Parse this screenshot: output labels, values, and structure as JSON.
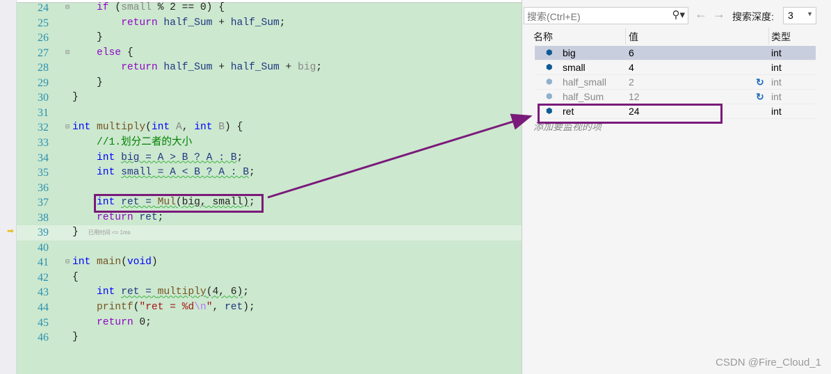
{
  "editor": {
    "lines": [
      {
        "n": "24",
        "fold": "⊟",
        "tokens": [
          [
            "",
            "    "
          ],
          [
            "ret",
            "if"
          ],
          [
            "",
            " ("
          ],
          [
            "dim",
            "small"
          ],
          [
            "",
            " % 2 == 0) {"
          ]
        ]
      },
      {
        "n": "25",
        "tokens": [
          [
            "",
            "        "
          ],
          [
            "ret",
            "return"
          ],
          [
            "",
            " "
          ],
          [
            "var",
            "half_Sum"
          ],
          [
            "",
            " + "
          ],
          [
            "var",
            "half_Sum"
          ],
          [
            "",
            ";"
          ]
        ]
      },
      {
        "n": "26",
        "tokens": [
          [
            "",
            "    }"
          ]
        ]
      },
      {
        "n": "27",
        "fold": "⊟",
        "tokens": [
          [
            "",
            "    "
          ],
          [
            "ret",
            "else"
          ],
          [
            "",
            " {"
          ]
        ]
      },
      {
        "n": "28",
        "tokens": [
          [
            "",
            "        "
          ],
          [
            "ret",
            "return"
          ],
          [
            "",
            " "
          ],
          [
            "var",
            "half_Sum"
          ],
          [
            "",
            " + "
          ],
          [
            "var",
            "half_Sum"
          ],
          [
            "",
            " + "
          ],
          [
            "dim",
            "big"
          ],
          [
            "",
            ";"
          ]
        ]
      },
      {
        "n": "29",
        "tokens": [
          [
            "",
            "    }"
          ]
        ]
      },
      {
        "n": "30",
        "tokens": [
          [
            "",
            "}"
          ]
        ]
      },
      {
        "n": "31",
        "tokens": []
      },
      {
        "n": "32",
        "fold": "⊟",
        "tokens": [
          [
            "kw",
            "int"
          ],
          [
            "",
            " "
          ],
          [
            "fn",
            "multiply"
          ],
          [
            "",
            "("
          ],
          [
            "kw",
            "int"
          ],
          [
            "",
            " "
          ],
          [
            "dim",
            "A"
          ],
          [
            "",
            ", "
          ],
          [
            "kw",
            "int"
          ],
          [
            "",
            " "
          ],
          [
            "dim",
            "B"
          ],
          [
            "",
            ") {"
          ]
        ]
      },
      {
        "n": "33",
        "tokens": [
          [
            "",
            "    "
          ],
          [
            "cm",
            "//1.划分二者的大小"
          ]
        ]
      },
      {
        "n": "34",
        "tokens": [
          [
            "",
            "    "
          ],
          [
            "kw",
            "int"
          ],
          [
            "",
            " "
          ],
          [
            "var sq",
            "big = A > B ? A : B"
          ],
          [
            "",
            ";"
          ]
        ]
      },
      {
        "n": "35",
        "tokens": [
          [
            "",
            "    "
          ],
          [
            "kw",
            "int"
          ],
          [
            "",
            " "
          ],
          [
            "var sq",
            "small = A < B ? A : B"
          ],
          [
            "",
            ";"
          ]
        ]
      },
      {
        "n": "36",
        "tokens": []
      },
      {
        "n": "37",
        "tokens": [
          [
            "",
            "    "
          ],
          [
            "kw",
            "int"
          ],
          [
            "",
            " "
          ],
          [
            "var sq",
            "ret = "
          ],
          [
            "fn sq",
            "Mul"
          ],
          [
            "sq",
            "(big, small)"
          ],
          [
            "",
            ";"
          ]
        ]
      },
      {
        "n": "38",
        "tokens": [
          [
            "",
            "    "
          ],
          [
            "ret",
            "return"
          ],
          [
            "",
            " "
          ],
          [
            "var",
            "ret"
          ],
          [
            "",
            ";"
          ]
        ]
      },
      {
        "n": "39",
        "current": true,
        "hint": "已用时间 <= 1ms",
        "tokens": [
          [
            "",
            "}"
          ]
        ]
      },
      {
        "n": "40",
        "tokens": []
      },
      {
        "n": "41",
        "fold": "⊟",
        "tokens": [
          [
            "kw",
            "int"
          ],
          [
            "",
            " "
          ],
          [
            "fn",
            "main"
          ],
          [
            "",
            "("
          ],
          [
            "kw",
            "void"
          ],
          [
            "",
            ")"
          ]
        ]
      },
      {
        "n": "42",
        "tokens": [
          [
            "",
            "{"
          ]
        ]
      },
      {
        "n": "43",
        "tokens": [
          [
            "",
            "    "
          ],
          [
            "kw",
            "int"
          ],
          [
            "",
            " "
          ],
          [
            "var sq",
            "ret = "
          ],
          [
            "fn sq",
            "multiply"
          ],
          [
            "sq",
            "(4, 6)"
          ],
          [
            "",
            ";"
          ]
        ]
      },
      {
        "n": "44",
        "tokens": [
          [
            "",
            "    "
          ],
          [
            "fn",
            "printf"
          ],
          [
            "",
            "("
          ],
          [
            "str",
            "\"ret = %d"
          ],
          [
            "esc",
            "\\n"
          ],
          [
            "str",
            "\""
          ],
          [
            "",
            ", "
          ],
          [
            "var",
            "ret"
          ],
          [
            "",
            ");"
          ]
        ]
      },
      {
        "n": "45",
        "tokens": [
          [
            "",
            "    "
          ],
          [
            "ret",
            "return"
          ],
          [
            "",
            " 0;"
          ]
        ]
      },
      {
        "n": "46",
        "tokens": [
          [
            "",
            "}"
          ]
        ]
      }
    ]
  },
  "watch": {
    "search_placeholder": "搜索(Ctrl+E)",
    "depth_label": "搜索深度:",
    "depth_value": "3",
    "columns": {
      "name": "名称",
      "value": "值",
      "type": "类型"
    },
    "rows": [
      {
        "name": "big",
        "value": "6",
        "type": "int",
        "selected": true
      },
      {
        "name": "small",
        "value": "4",
        "type": "int"
      },
      {
        "name": "half_small",
        "value": "2",
        "type": "int",
        "stale": true
      },
      {
        "name": "half_Sum",
        "value": "12",
        "type": "int",
        "stale": true
      },
      {
        "name": "ret",
        "value": "24",
        "type": "int"
      }
    ],
    "add_item": "添加要监视的项"
  },
  "annotation_color": "#7a1a7a",
  "watermark": "CSDN @Fire_Cloud_1"
}
